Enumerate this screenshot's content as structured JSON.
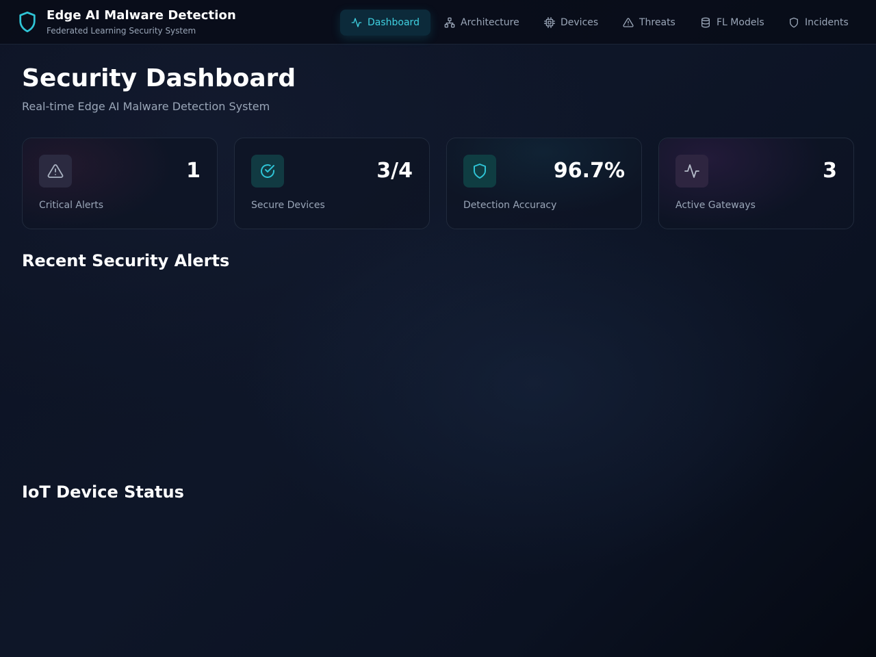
{
  "brand": {
    "title": "Edge AI Malware Detection",
    "subtitle": "Federated Learning Security System",
    "icon": "shield-icon"
  },
  "nav": [
    {
      "label": "Dashboard",
      "icon": "activity-icon",
      "active": true
    },
    {
      "label": "Architecture",
      "icon": "network-icon",
      "active": false
    },
    {
      "label": "Devices",
      "icon": "cpu-icon",
      "active": false
    },
    {
      "label": "Threats",
      "icon": "alert-triangle-icon",
      "active": false
    },
    {
      "label": "FL Models",
      "icon": "database-icon",
      "active": false
    },
    {
      "label": "Incidents",
      "icon": "shield-icon",
      "active": false
    }
  ],
  "page": {
    "title": "Security Dashboard",
    "subtitle": "Real-time Edge AI Malware Detection System"
  },
  "stats": [
    {
      "value": "1",
      "label": "Critical Alerts",
      "icon": "alert-triangle-icon",
      "color": "#b34a6a"
    },
    {
      "value": "3/4",
      "label": "Secure Devices",
      "icon": "check-circle-icon",
      "color": "#2bc0c8"
    },
    {
      "value": "96.7%",
      "label": "Detection Accuracy",
      "icon": "shield-icon",
      "color": "#2bc0c8"
    },
    {
      "value": "3",
      "label": "Active Gateways",
      "icon": "activity-icon",
      "color": "#b34a9a"
    }
  ],
  "sections": {
    "alerts_title": "Recent Security Alerts",
    "devices_title": "IoT Device Status"
  },
  "colors": {
    "accent": "#3fd0e0",
    "background": "#0c1222",
    "text_muted": "#9aa6b8"
  }
}
